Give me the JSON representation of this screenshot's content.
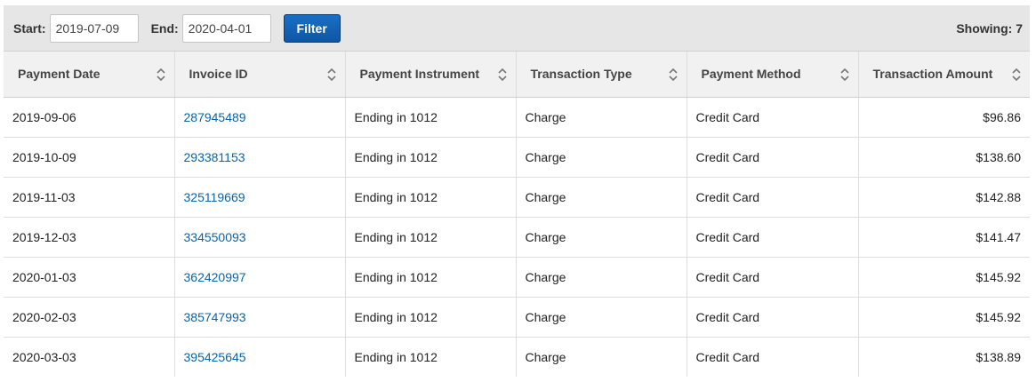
{
  "filter": {
    "start_label": "Start:",
    "start_value": "2019-07-09",
    "end_label": "End:",
    "end_value": "2020-04-01",
    "button_label": "Filter",
    "showing": "Showing: 7"
  },
  "table": {
    "columns": [
      "Payment Date",
      "Invoice ID",
      "Payment Instrument",
      "Transaction Type",
      "Payment Method",
      "Transaction Amount"
    ],
    "rows": [
      [
        "2019-09-06",
        "287945489",
        "Ending in 1012",
        "Charge",
        "Credit Card",
        "$96.86"
      ],
      [
        "2019-10-09",
        "293381153",
        "Ending in 1012",
        "Charge",
        "Credit Card",
        "$138.60"
      ],
      [
        "2019-11-03",
        "325119669",
        "Ending in 1012",
        "Charge",
        "Credit Card",
        "$142.88"
      ],
      [
        "2019-12-03",
        "334550093",
        "Ending in 1012",
        "Charge",
        "Credit Card",
        "$141.47"
      ],
      [
        "2020-01-03",
        "362420997",
        "Ending in 1012",
        "Charge",
        "Credit Card",
        "$145.92"
      ],
      [
        "2020-02-03",
        "385747993",
        "Ending in 1012",
        "Charge",
        "Credit Card",
        "$145.92"
      ],
      [
        "2020-03-03",
        "395425645",
        "Ending in 1012",
        "Charge",
        "Credit Card",
        "$138.89"
      ]
    ]
  },
  "colors": {
    "accent": "#0e56a6",
    "link": "#0b63a8",
    "header_bg": "#f1f1f1",
    "toolbar_bg": "#e6e6e6"
  },
  "icons": {
    "sort": "sort-icon"
  }
}
